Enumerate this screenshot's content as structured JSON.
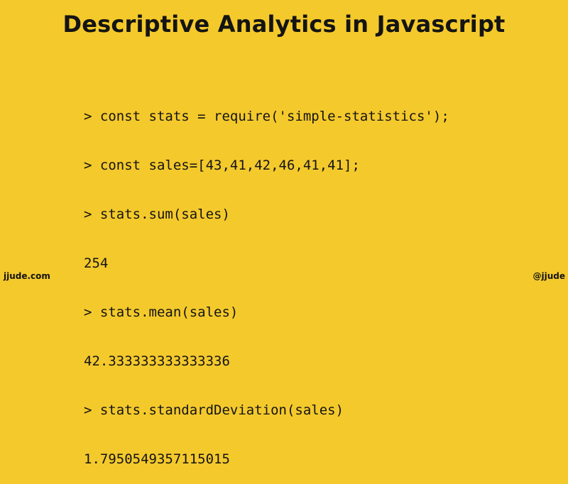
{
  "title": "Descriptive Analytics in Javascript",
  "console": {
    "lines": [
      "> const stats = require('simple-statistics');",
      "> const sales=[43,41,42,46,41,41];",
      "> stats.sum(sales)",
      "254",
      "> stats.mean(sales)",
      "42.333333333333336",
      "> stats.standardDeviation(sales)",
      "1.7950549357115015"
    ]
  },
  "footer": {
    "site": "jjude.com",
    "handle": "@jjude"
  },
  "colors": {
    "background": "#f4c92c",
    "text": "#141414"
  }
}
